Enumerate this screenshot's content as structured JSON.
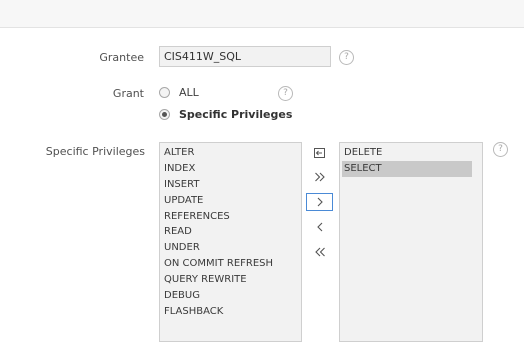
{
  "form": {
    "grantee": {
      "label": "Grantee",
      "value": "CIS411W_SQL",
      "help": "?"
    },
    "grant": {
      "label": "Grant",
      "options": [
        {
          "label": "ALL",
          "checked": false
        },
        {
          "label": "Specific Privileges",
          "checked": true
        }
      ],
      "help": "?"
    },
    "specific_privileges": {
      "label": "Specific Privileges",
      "help": "?",
      "available": [
        "ALTER",
        "INDEX",
        "INSERT",
        "UPDATE",
        "REFERENCES",
        "READ",
        "UNDER",
        "ON COMMIT REFRESH",
        "QUERY REWRITE",
        "DEBUG",
        "FLASHBACK"
      ],
      "selected": [
        "DELETE",
        "SELECT"
      ],
      "highlighted_selected": "SELECT",
      "shuttle_buttons": [
        {
          "name": "reset",
          "icon": "undo-icon"
        },
        {
          "name": "move-all",
          "icon": "double-chevron-right-icon"
        },
        {
          "name": "move",
          "icon": "chevron-right-icon",
          "focused": true
        },
        {
          "name": "remove",
          "icon": "chevron-left-icon"
        },
        {
          "name": "remove-all",
          "icon": "double-chevron-left-icon"
        }
      ]
    }
  }
}
